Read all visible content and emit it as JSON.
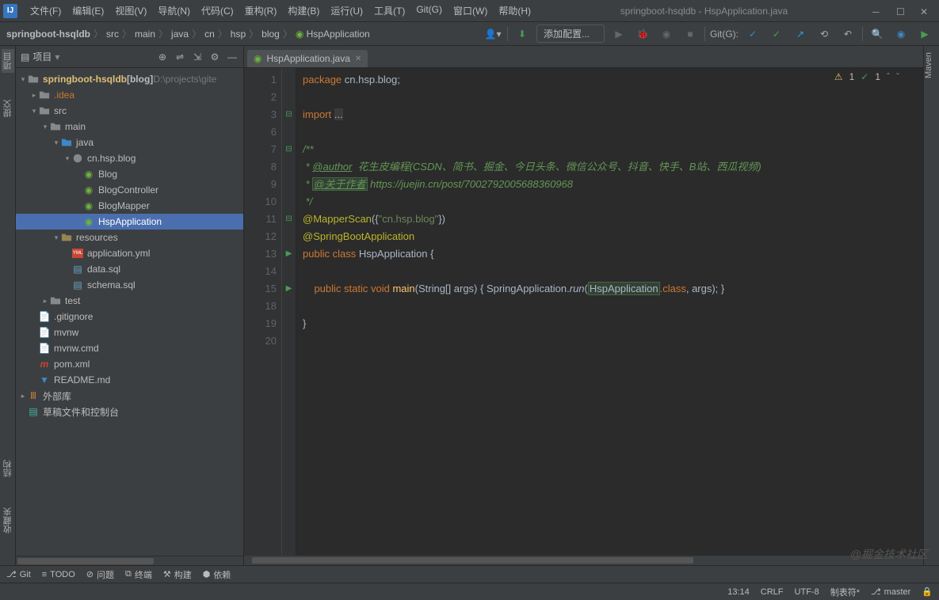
{
  "title": "springboot-hsqldb - HspApplication.java",
  "menus": [
    "文件(F)",
    "编辑(E)",
    "视图(V)",
    "导航(N)",
    "代码(C)",
    "重构(R)",
    "构建(B)",
    "运行(U)",
    "工具(T)",
    "Git(G)",
    "窗口(W)",
    "帮助(H)"
  ],
  "breadcrumbs": [
    "springboot-hsqldb",
    "src",
    "main",
    "java",
    "cn",
    "hsp",
    "blog",
    "HspApplication"
  ],
  "configLabel": "添加配置...",
  "gitLabel": "Git(G):",
  "sidebar": {
    "title": "项目",
    "root": "springboot-hsqldb",
    "rootTag": "[blog]",
    "rootPath": "D:\\projects\\gite",
    "idea": ".idea",
    "src": "src",
    "main": "main",
    "java": "java",
    "package": "cn.hsp.blog",
    "classes": [
      "Blog",
      "BlogController",
      "BlogMapper",
      "HspApplication"
    ],
    "resources": "resources",
    "resFiles": [
      "application.yml",
      "data.sql",
      "schema.sql"
    ],
    "test": "test",
    "gitignore": ".gitignore",
    "mvnw": "mvnw",
    "mvnwcmd": "mvnw.cmd",
    "pom": "pom.xml",
    "readme": "README.md",
    "external": "外部库",
    "scratch": "草稿文件和控制台"
  },
  "tab": {
    "filename": "HspApplication.java"
  },
  "code": {
    "package": "package ",
    "pkgname": "cn.hsp.blog",
    "import": "import ",
    "ellipsis": "...",
    "authorTag": "@author",
    "authorText": "花生皮编程(CSDN、简书、掘金、今日头条、微信公众号、抖音、快手、B站、西瓜视频)",
    "aboutTag": "@关于作者",
    "aboutUrl": "https://juejin.cn/post/7002792005688360968",
    "mapperScan": "@MapperScan",
    "mapperArg": "\"cn.hsp.blog\"",
    "springBoot": "@SpringBootApplication",
    "pub": "public ",
    "cls": "class ",
    "clsName": "HspApplication",
    "static": "static ",
    "void": "void ",
    "main": "main",
    "mainArgs": "(String[] args) { ",
    "springApp": "SpringApplication",
    "run": "run",
    "classTk": ".class",
    "argsEnd": ", args); }"
  },
  "lineNumbers": [
    "1",
    "2",
    "3",
    "6",
    "7",
    "8",
    "9",
    "10",
    "11",
    "12",
    "13",
    "14",
    "15",
    "18",
    "19",
    "20"
  ],
  "hints": {
    "warn": "1",
    "ok": "1"
  },
  "leftRail": [
    "项目",
    "提交"
  ],
  "rightRailText": "Maven",
  "toolwin": [
    "Git",
    "TODO",
    "问题",
    "终端",
    "构建",
    "依赖"
  ],
  "toolwinIcons": [
    "⎇",
    "≡",
    "⊘",
    "⧉",
    "⚒",
    "⬢"
  ],
  "status": {
    "time": "13:14",
    "lf": "CRLF",
    "enc": "UTF-8",
    "tab": "制表符*",
    "branch": "master"
  },
  "watermark": "@掘金技术社区",
  "rail2": [
    "结构",
    "收藏夹"
  ]
}
